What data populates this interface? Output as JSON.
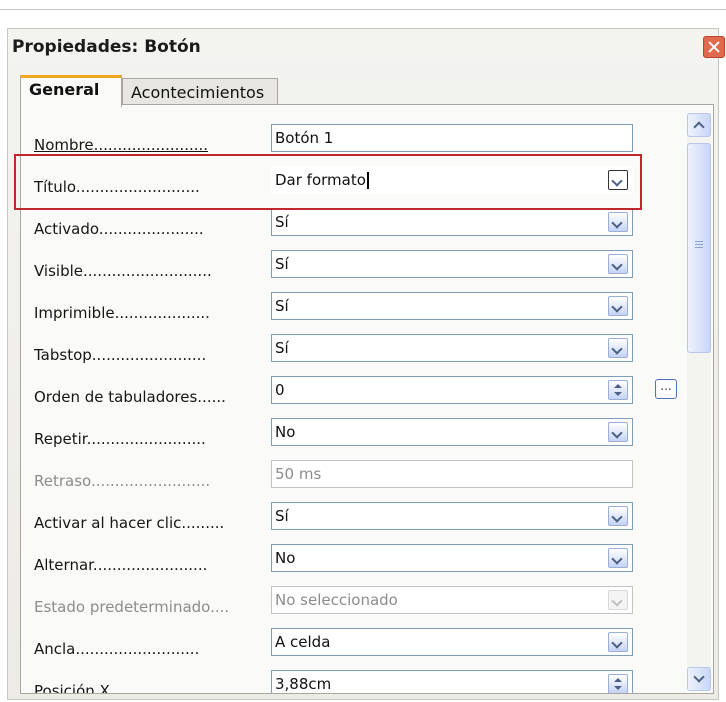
{
  "window": {
    "title": "Propiedades: Botón"
  },
  "tabs": [
    {
      "label": "General",
      "selected": true
    },
    {
      "label": "Acontecimientos",
      "selected": false
    }
  ],
  "properties": [
    {
      "label": "Nombre........................",
      "value": "Botón 1",
      "control": "text",
      "enabled": true
    },
    {
      "label": "Título..........................",
      "value": "Dar formato",
      "control": "dropdown",
      "enabled": true,
      "highlighted": true,
      "focused": true
    },
    {
      "label": "Activado......................",
      "value": "Sí",
      "control": "dropdown",
      "enabled": true
    },
    {
      "label": "Visible...........................",
      "value": "Sí",
      "control": "dropdown",
      "enabled": true
    },
    {
      "label": "Imprimible....................",
      "value": "Sí",
      "control": "dropdown",
      "enabled": true
    },
    {
      "label": "Tabstop........................",
      "value": "Sí",
      "control": "dropdown",
      "enabled": true
    },
    {
      "label": "Orden de tabuladores......",
      "value": "0",
      "control": "spin",
      "enabled": true,
      "ellipsis_label": "..."
    },
    {
      "label": "Repetir.........................",
      "value": "No",
      "control": "dropdown",
      "enabled": true
    },
    {
      "label": "Retraso.........................",
      "value": "50 ms",
      "control": "text",
      "enabled": false
    },
    {
      "label": "Activar al hacer clic.........",
      "value": "Sí",
      "control": "dropdown",
      "enabled": true
    },
    {
      "label": "Alternar........................",
      "value": "No",
      "control": "dropdown",
      "enabled": true
    },
    {
      "label": "Estado predeterminado....",
      "value": "No seleccionado",
      "control": "dropdown",
      "enabled": false
    },
    {
      "label": "Ancla..........................",
      "value": "A celda",
      "control": "dropdown",
      "enabled": true
    },
    {
      "label": "Posición X....................",
      "value": "3,88cm",
      "control": "spin",
      "enabled": true
    }
  ],
  "colors": {
    "highlight_border": "#c0272d",
    "tab_accent": "#f0a820",
    "close_button": "#e06a4e"
  }
}
